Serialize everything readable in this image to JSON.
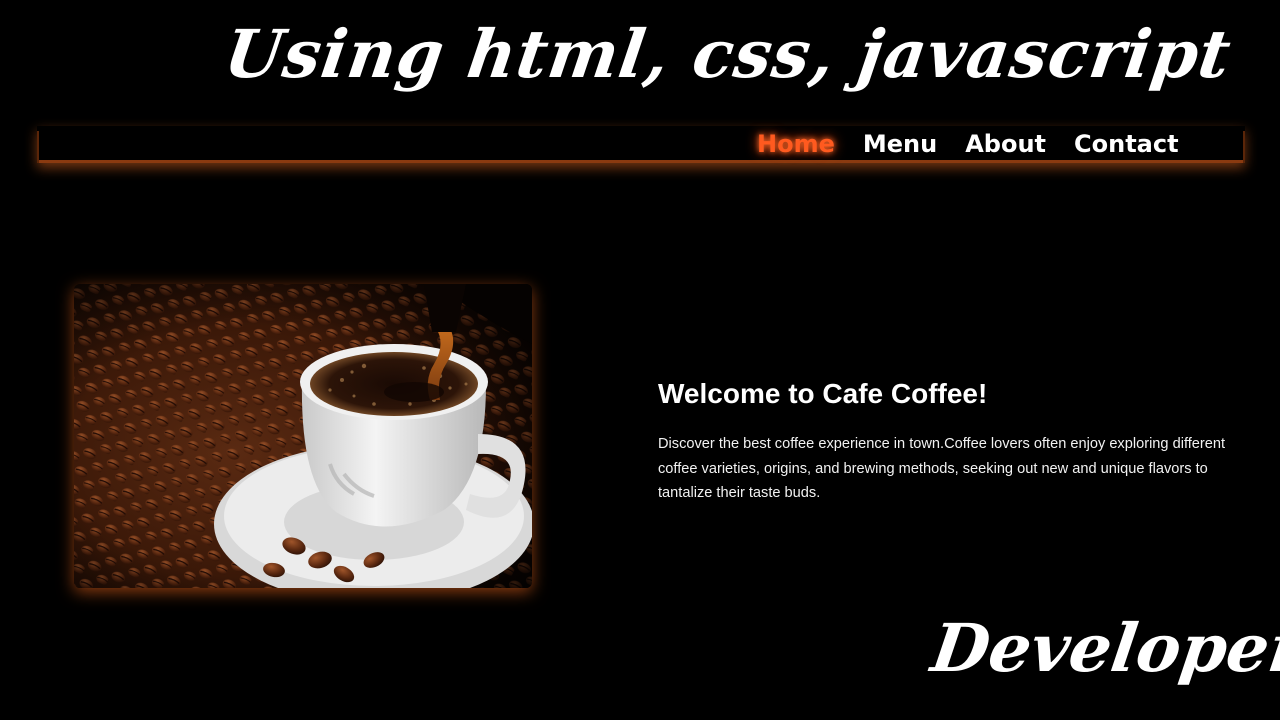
{
  "banner": {
    "title": "Using html, css, javascript",
    "footer": "Developer"
  },
  "nav": {
    "items": [
      {
        "label": "Home",
        "active": true
      },
      {
        "label": "Menu",
        "active": false
      },
      {
        "label": "About",
        "active": false
      },
      {
        "label": "Contact",
        "active": false
      }
    ]
  },
  "hero": {
    "heading": "Welcome to Cafe Coffee!",
    "text": "Discover the best coffee experience in town.Coffee lovers often enjoy exploring different coffee varieties, origins, and brewing methods, seeking out new and unique flavors to tantalize their taste buds.",
    "image_name": "coffee-cup-with-beans"
  },
  "colors": {
    "background": "#000000",
    "accent": "#ff5a1f",
    "glow": "#ff6e1e",
    "text": "#ffffff"
  }
}
